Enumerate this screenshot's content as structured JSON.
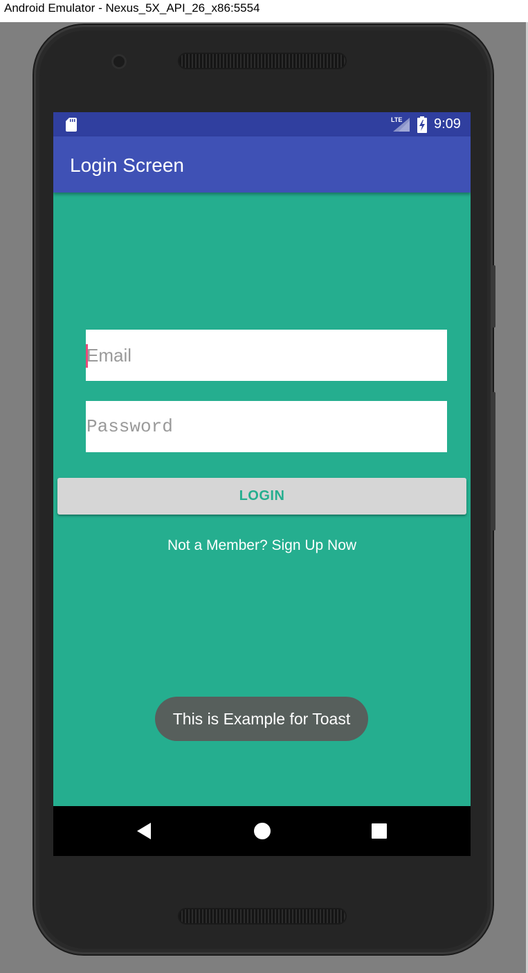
{
  "window": {
    "title": "Android Emulator - Nexus_5X_API_26_x86:5554"
  },
  "status_bar": {
    "network": "LTE",
    "time": "9:09",
    "color": "#303f9f"
  },
  "app_bar": {
    "title": "Login Screen",
    "color": "#3f51b5"
  },
  "login_form": {
    "background": "#25ae8f",
    "email": {
      "value": "",
      "placeholder": "Email"
    },
    "password": {
      "value": "",
      "placeholder": "Password"
    },
    "login_label": "LOGIN",
    "signup_text": "Not a Member? Sign Up Now"
  },
  "toast": {
    "message": "This is Example for Toast"
  },
  "nav_bar": {
    "back_icon": "back-triangle-icon",
    "home_icon": "home-circle-icon",
    "recents_icon": "recents-square-icon"
  }
}
